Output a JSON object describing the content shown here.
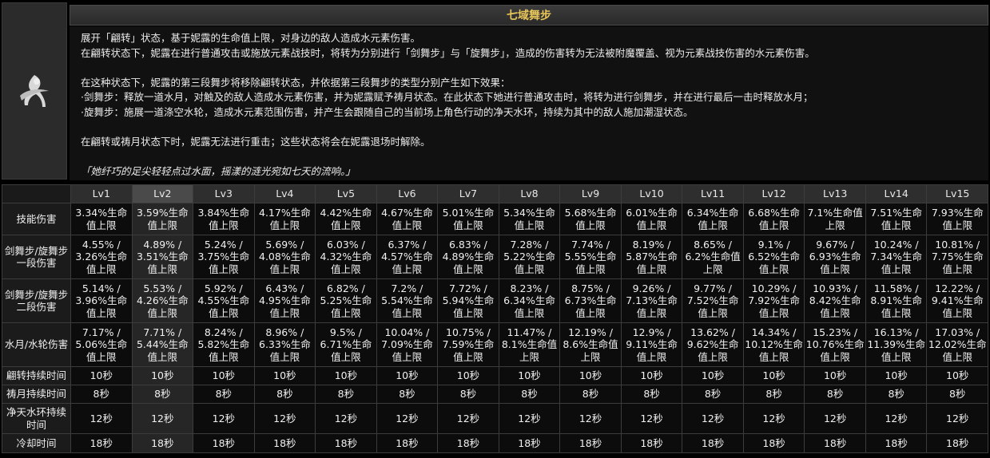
{
  "skill": {
    "icon": "nilou-dance-silhouette-icon",
    "title": "七域舞步",
    "description": [
      "展开「翩转」状态，基于妮露的生命值上限，对身边的敌人造成水元素伤害。",
      "在翩转状态下，妮露在进行普通攻击或施放元素战技时，将转为分别进行「剑舞步」与「旋舞步」，造成的伤害转为无法被附魔覆盖、视为元素战技伤害的水元素伤害。",
      "",
      "在这种状态下，妮露的第三段舞步将移除翩转状态，并依据第三段舞步的类型分别产生如下效果：",
      "·剑舞步：释放一道水月，对触及的敌人造成水元素伤害，并为妮露赋予祷月状态。在此状态下她进行普通攻击时，将转为进行剑舞步，并在进行最后一击时释放水月；",
      "·旋舞步：施展一道涤空水轮，造成水元素范围伤害，并产生会跟随自己的当前场上角色行动的净天水环，持续为其中的敌人施加潮湿状态。",
      "",
      "在翩转或祷月状态下时，妮露无法进行重击；这些状态将会在妮露退场时解除。",
      ""
    ],
    "quote": "「她纤巧的足尖轻轻点过水面，摇漾的涟光宛如七天的流响。」"
  },
  "table": {
    "levels": [
      "Lv1",
      "Lv2",
      "Lv3",
      "Lv4",
      "Lv5",
      "Lv6",
      "Lv7",
      "Lv8",
      "Lv9",
      "Lv10",
      "Lv11",
      "Lv12",
      "Lv13",
      "Lv14",
      "Lv15"
    ],
    "highlight_col": 1,
    "rows": [
      {
        "label": "技能伤害",
        "height": 40,
        "values": [
          "3.34%生命值上限",
          "3.59%生命值上限",
          "3.84%生命值上限",
          "4.17%生命值上限",
          "4.42%生命值上限",
          "4.67%生命值上限",
          "5.01%生命值上限",
          "5.34%生命值上限",
          "5.68%生命值上限",
          "6.01%生命值上限",
          "6.34%生命值上限",
          "6.68%生命值上限",
          "7.1%生命值上限",
          "7.51%生命值上限",
          "7.93%生命值上限"
        ]
      },
      {
        "label": "剑舞步/旋舞步一段伤害",
        "height": 55,
        "values": [
          "4.55% / 3.26%生命值上限",
          "4.89% / 3.51%生命值上限",
          "5.24% / 3.75%生命值上限",
          "5.69% / 4.08%生命值上限",
          "6.03% / 4.32%生命值上限",
          "6.37% / 4.57%生命值上限",
          "6.83% / 4.89%生命值上限",
          "7.28% / 5.22%生命值上限",
          "7.74% / 5.55%生命值上限",
          "8.19% / 5.87%生命值上限",
          "8.65% / 6.2%生命值上限",
          "9.1% / 6.52%生命值上限",
          "9.67% / 6.93%生命值上限",
          "10.24% / 7.34%生命值上限",
          "10.81% / 7.75%生命值上限"
        ]
      },
      {
        "label": "剑舞步/旋舞步二段伤害",
        "height": 55,
        "values": [
          "5.14% / 3.96%生命值上限",
          "5.53% / 4.26%生命值上限",
          "5.92% / 4.55%生命值上限",
          "6.43% / 4.95%生命值上限",
          "6.82% / 5.25%生命值上限",
          "7.2% / 5.54%生命值上限",
          "7.72% / 5.94%生命值上限",
          "8.23% / 6.34%生命值上限",
          "8.75% / 6.73%生命值上限",
          "9.26% / 7.13%生命值上限",
          "9.77% / 7.52%生命值上限",
          "10.29% / 7.92%生命值上限",
          "10.93% / 8.42%生命值上限",
          "11.58% / 8.91%生命值上限",
          "12.22% / 9.41%生命值上限"
        ]
      },
      {
        "label": "水月/水轮伤害",
        "height": 55,
        "values": [
          "7.17% / 5.06%生命值上限",
          "7.71% / 5.44%生命值上限",
          "8.24% / 5.82%生命值上限",
          "8.96% / 6.33%生命值上限",
          "9.5% / 6.71%生命值上限",
          "10.04% / 7.09%生命值上限",
          "10.75% / 7.59%生命值上限",
          "11.47% / 8.1%生命值上限",
          "12.19% / 8.6%生命值上限",
          "12.9% / 9.11%生命值上限",
          "13.62% / 9.62%生命值上限",
          "14.34% / 10.12%生命值上限",
          "15.23% / 10.76%生命值上限",
          "16.13% / 11.39%生命值上限",
          "17.03% / 12.02%生命值上限"
        ]
      },
      {
        "label": "翩转持续时间",
        "height": 23,
        "values": [
          "10秒",
          "10秒",
          "10秒",
          "10秒",
          "10秒",
          "10秒",
          "10秒",
          "10秒",
          "10秒",
          "10秒",
          "10秒",
          "10秒",
          "10秒",
          "10秒",
          "10秒"
        ]
      },
      {
        "label": "祷月持续时间",
        "height": 23,
        "values": [
          "8秒",
          "8秒",
          "8秒",
          "8秒",
          "8秒",
          "8秒",
          "8秒",
          "8秒",
          "8秒",
          "8秒",
          "8秒",
          "8秒",
          "8秒",
          "8秒",
          "8秒"
        ]
      },
      {
        "label": "净天水环持续时间",
        "height": 38,
        "values": [
          "12秒",
          "12秒",
          "12秒",
          "12秒",
          "12秒",
          "12秒",
          "12秒",
          "12秒",
          "12秒",
          "12秒",
          "12秒",
          "12秒",
          "12秒",
          "12秒",
          "12秒"
        ]
      },
      {
        "label": "冷却时间",
        "height": 24,
        "values": [
          "18秒",
          "18秒",
          "18秒",
          "18秒",
          "18秒",
          "18秒",
          "18秒",
          "18秒",
          "18秒",
          "18秒",
          "18秒",
          "18秒",
          "18秒",
          "18秒",
          "18秒"
        ]
      }
    ]
  }
}
